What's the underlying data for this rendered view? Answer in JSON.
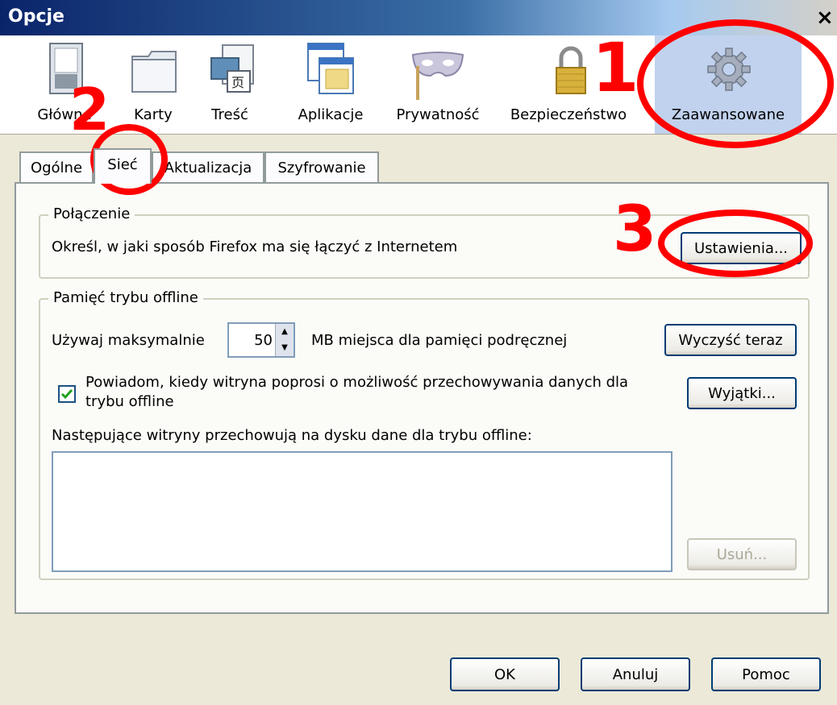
{
  "window": {
    "title": "Opcje",
    "close_symbol": "×"
  },
  "toolbar": {
    "items": [
      {
        "label": "Główne",
        "icon": "switch-icon"
      },
      {
        "label": "Karty",
        "icon": "folder-tabs-icon"
      },
      {
        "label": "Treść",
        "icon": "content-icon"
      },
      {
        "label": "Aplikacje",
        "icon": "applications-icon"
      },
      {
        "label": "Prywatność",
        "icon": "mask-icon"
      },
      {
        "label": "Bezpieczeństwo",
        "icon": "padlock-icon"
      },
      {
        "label": "Zaawansowane",
        "icon": "gear-icon",
        "selected": true
      }
    ]
  },
  "tabs": [
    {
      "label": "Ogólne"
    },
    {
      "label": "Sieć",
      "selected": true
    },
    {
      "label": "Aktualizacja"
    },
    {
      "label": "Szyfrowanie"
    }
  ],
  "connection": {
    "group_label": "Połączenie",
    "description": "Określ, w jaki sposób Firefox ma się łączyć z Internetem",
    "settings_button": "Ustawienia..."
  },
  "offline": {
    "group_label": "Pamięć trybu offline",
    "use_max_label": "Używaj maksymalnie",
    "max_value": "50",
    "mb_label": "MB miejsca dla pamięci podręcznej",
    "clear_button": "Wyczyść teraz",
    "notify_checkbox_line1": "Powiadom, kiedy witryna poprosi o możliwość przechowywania danych dla",
    "notify_checkbox_line2": "trybu offline",
    "notify_checked": true,
    "exceptions_button": "Wyjątki...",
    "sites_label": "Następujące witryny przechowują na dysku dane dla trybu offline:",
    "sites": [],
    "remove_button": "Usuń..."
  },
  "dialog_buttons": {
    "ok": "OK",
    "cancel": "Anuluj",
    "help": "Pomoc"
  },
  "annotations": {
    "one": "1",
    "two": "2",
    "three": "3",
    "color": "#ff0000"
  }
}
